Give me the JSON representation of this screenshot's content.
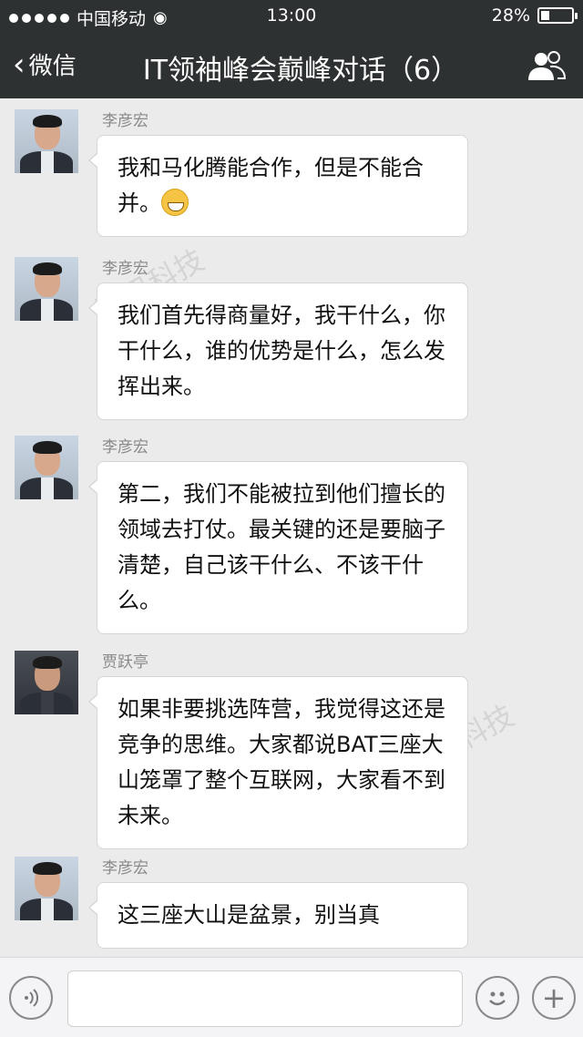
{
  "status_bar": {
    "carrier": "中国移动",
    "time": "13:00",
    "battery": "28%",
    "battery_level": 0.28
  },
  "nav": {
    "back_label": "微信",
    "title": "IT领袖峰会巅峰对话（6）",
    "contacts_icon": "contacts-icon"
  },
  "messages": [
    {
      "sender": "李彦宏",
      "text": "我和马化腾能合作，但是不能合并。",
      "emoji": "grimace-emoji"
    },
    {
      "sender": "李彦宏",
      "text": "我们首先得商量好，我干什么，你干什么，谁的优势是什么，怎么发挥出来。"
    },
    {
      "sender": "李彦宏",
      "text": "第二，我们不能被拉到他们擅长的领域去打仗。最关键的还是要脑子清楚，自己该干什么、不该干什么。"
    },
    {
      "sender": "贾跃亭",
      "text": "如果非要挑选阵营，我觉得这还是竞争的思维。大家都说BAT三座大山笼罩了整个互联网，大家看不到未来。"
    },
    {
      "sender": "李彦宏",
      "text": "这三座大山是盆景，别当真"
    }
  ],
  "watermark": "腾讯科技",
  "input_bar": {
    "voice_icon": "voice-icon",
    "emoji_icon": "emoji-icon",
    "plus_icon": "plus-icon"
  }
}
